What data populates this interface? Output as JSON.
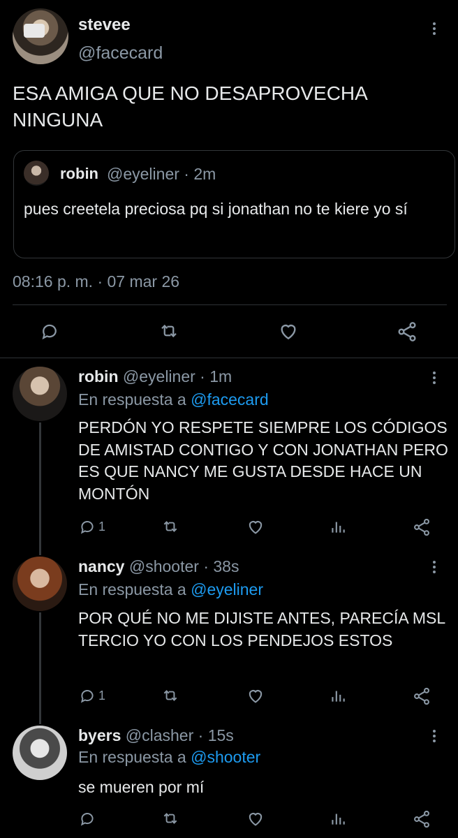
{
  "main_tweet": {
    "name": "stevee",
    "handle": "@facecard",
    "text": "ESA AMIGA QUE NO DESAPROVECHA NINGUNA",
    "quote": {
      "name": "robin",
      "meta": "@eyeliner · 2m",
      "text": "pues creetela preciosa pq si jonathan no te kiere yo sí"
    },
    "timestamp": "08:16 p. m. · 07 mar 26"
  },
  "replies": [
    {
      "name": "robin",
      "handle": "@eyeliner · 1m",
      "reply_prefix": "En respuesta a ",
      "reply_to": "@facecard",
      "text": "PERDÓN YO RESPETE SIEMPRE LOS CÓDIGOS DE AMISTAD CONTIGO Y CON JONATHAN PERO ES QUE NANCY ME GUSTA DESDE HACE UN MONTÓN",
      "reply_count": "1"
    },
    {
      "name": "nancy",
      "handle": "@shooter · 38s",
      "reply_prefix": "En respuesta a ",
      "reply_to": "@eyeliner",
      "text": "POR QUÉ NO ME DIJISTE ANTES, PARECÍA MSL TERCIO YO CON LOS PENDEJOS ESTOS",
      "reply_count": "1"
    },
    {
      "name": "byers",
      "handle": "@clasher · 15s",
      "reply_prefix": "En respuesta a ",
      "reply_to": "@shooter",
      "text": "se mueren por mí",
      "reply_count": ""
    }
  ],
  "icons": [
    "more-icon",
    "reply-icon",
    "retweet-icon",
    "like-icon",
    "share-icon",
    "analytics-icon"
  ],
  "colors": {
    "background": "#000000",
    "text": "#e7e9ea",
    "secondary": "#8b98a5",
    "link": "#1d9bf0",
    "border": "#2f3336"
  }
}
